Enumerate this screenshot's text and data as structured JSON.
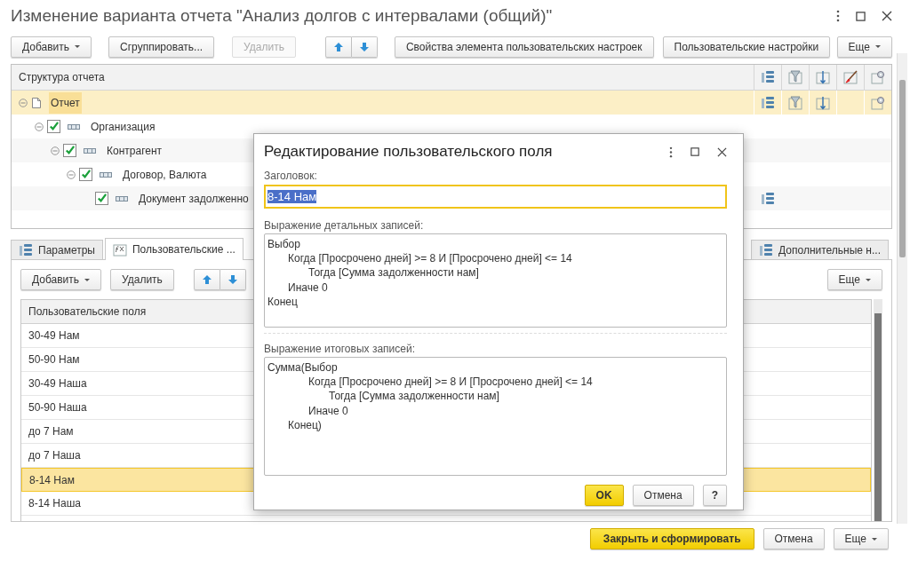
{
  "window": {
    "title": "Изменение варианта отчета \"Анализ долгов с интервалами (общий)\""
  },
  "toolbar": [
    {
      "kind": "dropdown",
      "label": "Добавить",
      "disabled": false
    },
    {
      "kind": "plain",
      "label": "Сгруппировать...",
      "disabled": false
    },
    {
      "kind": "plain",
      "label": "Удалить",
      "disabled": true
    },
    {
      "kind": "move",
      "disabled": false
    },
    {
      "kind": "plain",
      "label": "Свойства элемента пользовательских настроек",
      "disabled": false
    },
    {
      "kind": "plain",
      "label": "Пользовательские настройки",
      "disabled": false
    },
    {
      "kind": "more",
      "label": "Еще",
      "disabled": false
    }
  ],
  "structure": {
    "title": "Структура отчета",
    "columns": [
      {
        "kind": "table"
      },
      {
        "kind": "filter"
      },
      {
        "kind": "sort"
      },
      {
        "kind": "brush"
      },
      {
        "kind": "gear"
      }
    ],
    "rows": [
      {
        "label": "Отчет",
        "kind": "report",
        "selected": true,
        "expanded": true,
        "icons": [
          true,
          true,
          true,
          false,
          true
        ],
        "children": [
          {
            "label": "Организация",
            "kind": "field",
            "selected": false,
            "checked": true,
            "expanded": true,
            "icons": [
              false,
              false,
              false,
              false,
              false
            ],
            "children": [
              {
                "label": "Контрагент",
                "kind": "field",
                "selected": false,
                "checked": true,
                "expanded": true,
                "icons": [
                  false,
                  false,
                  false,
                  false,
                  false
                ],
                "children": [
                  {
                    "label": "Договор, Валюта",
                    "kind": "field",
                    "selected": false,
                    "checked": true,
                    "expanded": true,
                    "icons": [
                      false,
                      false,
                      false,
                      false,
                      false
                    ],
                    "children": [
                      {
                        "label": "Документ задолженно",
                        "kind": "field",
                        "selected": false,
                        "checked": true,
                        "icons": [
                          true,
                          false,
                          false,
                          false,
                          false
                        ]
                      }
                    ]
                  }
                ]
              }
            ]
          }
        ]
      }
    ]
  },
  "tabs": [
    {
      "label": "Параметры",
      "kind": "table",
      "selected": false
    },
    {
      "label": "Пользовательские ...",
      "kind": "formula",
      "selected": true
    },
    {
      "label": "Дополнительные н...",
      "kind": "table",
      "selected": false
    }
  ],
  "panel_toolbar": [
    {
      "kind": "dropdown",
      "label": "Добавить",
      "disabled": false
    },
    {
      "kind": "plain",
      "label": "Удалить",
      "disabled": false
    },
    {
      "kind": "move",
      "disabled": false
    },
    {
      "kind": "more",
      "label": "Еще",
      "disabled": false
    }
  ],
  "fields": {
    "column": "Пользовательские поля",
    "rows": [
      {
        "label": "30-49 Нам",
        "selected": false
      },
      {
        "label": "50-90 Нам",
        "selected": false
      },
      {
        "label": "30-49 Наша",
        "selected": false
      },
      {
        "label": "50-90 Наша",
        "selected": false
      },
      {
        "label": "до 7 Нам",
        "selected": false
      },
      {
        "label": "до 7 Наша",
        "selected": false
      },
      {
        "label": "8-14 Нам",
        "selected": true
      },
      {
        "label": "8-14 Наша",
        "selected": false
      }
    ]
  },
  "footer": [
    {
      "kind": "primary",
      "label": "Закрыть и сформировать"
    },
    {
      "kind": "plain",
      "label": "Отмена"
    },
    {
      "kind": "more",
      "label": "Еще"
    }
  ],
  "dialog": {
    "title": "Редактирование пользовательского поля",
    "title_field": {
      "label": "Заголовок:",
      "value": "8-14 Нам",
      "text_selected": true
    },
    "detail_expression": {
      "label": "Выражение детальных записей:",
      "value": "Выбор\n\tКогда [Просрочено дней] >= 8 И [Просрочено дней] <= 14\n\t\tТогда [Сумма задолженности нам]\n\tИначе 0\nКонец"
    },
    "total_expression": {
      "label": "Выражение итоговых записей:",
      "value": "Сумма(Выбор\n\t\tКогда [Просрочено дней] >= 8 И [Просрочено дней] <= 14\n\t\t\tТогда [Сумма задолженности нам]\n\t\tИначе 0\n\tКонец)"
    },
    "buttons": [
      {
        "kind": "primary",
        "label": "OK"
      },
      {
        "kind": "plain",
        "label": "Отмена"
      },
      {
        "kind": "help",
        "label": "?"
      }
    ]
  }
}
